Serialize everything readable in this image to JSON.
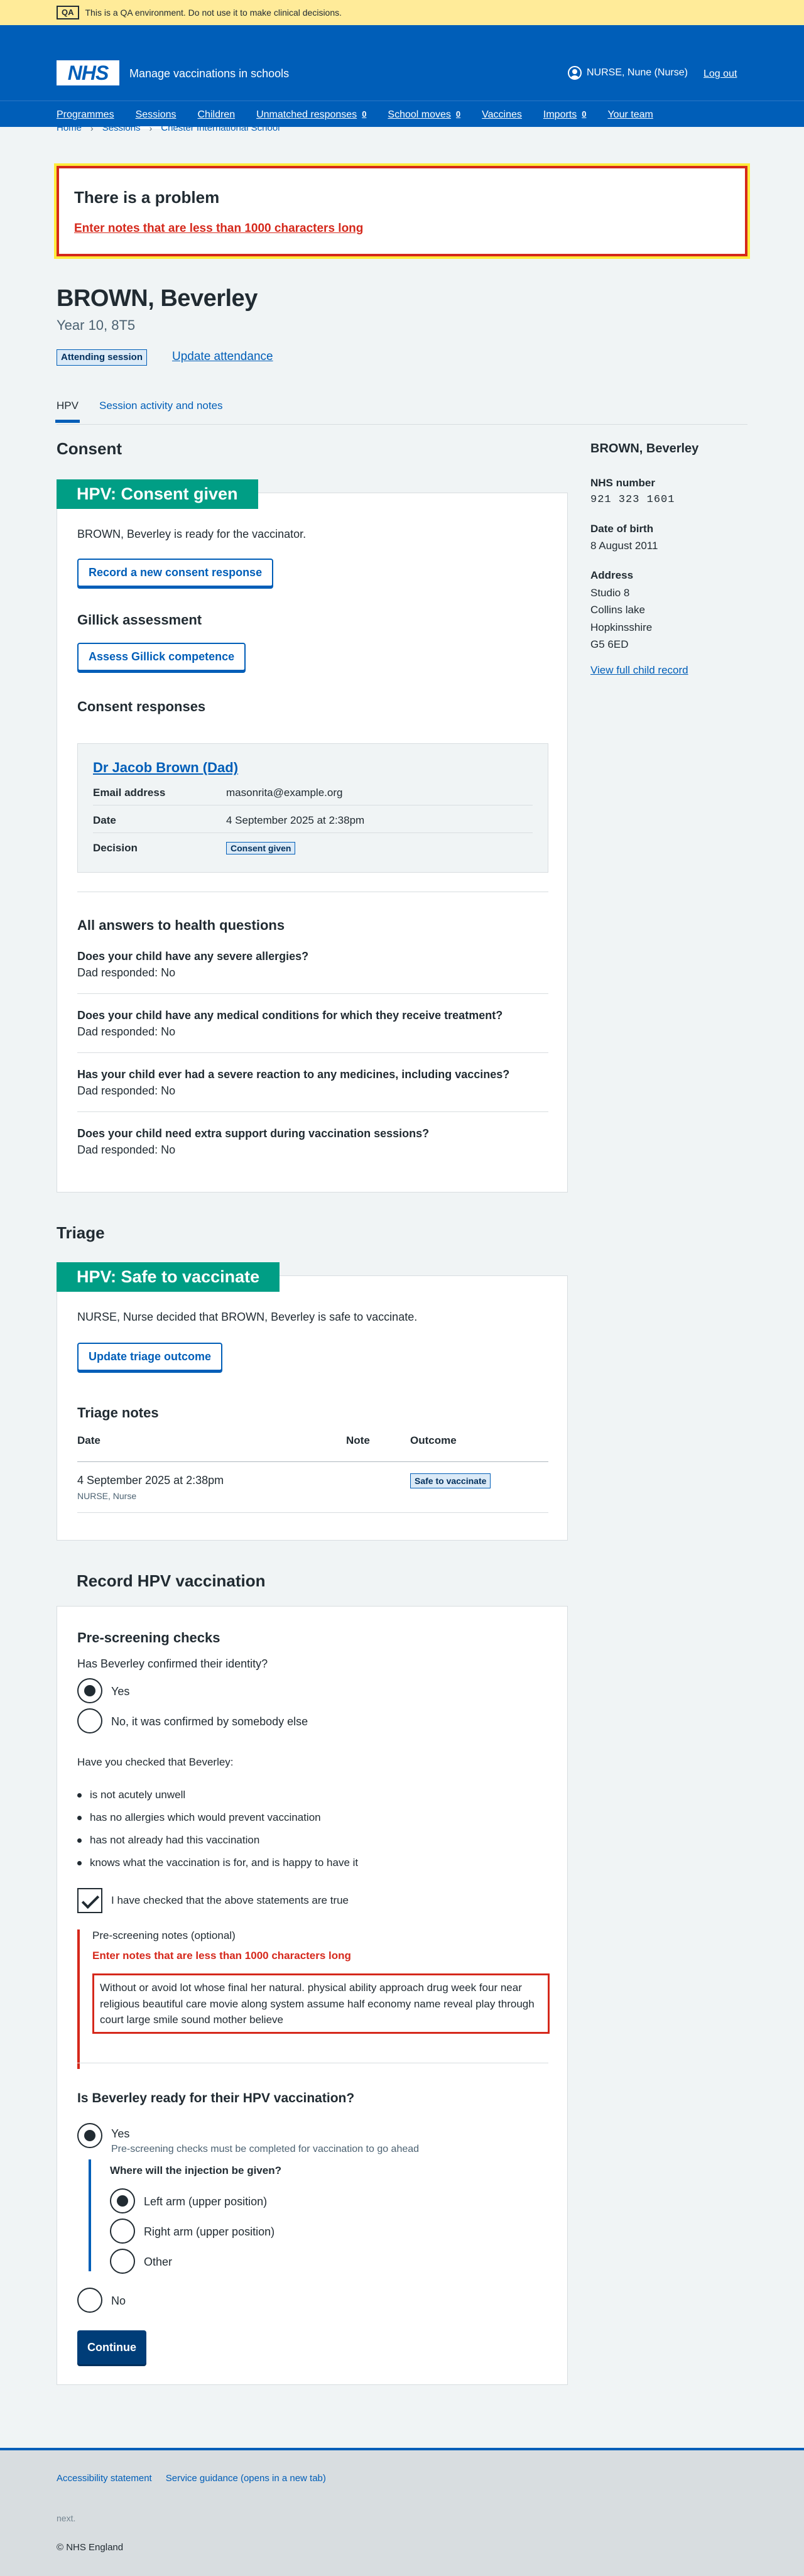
{
  "qa_banner": {
    "tag": "QA",
    "text": "This is a QA environment. Do not use it to make clinical decisions."
  },
  "header": {
    "logo": "NHS",
    "service": "Manage vaccinations in schools",
    "user": "NURSE, Nune (Nurse)",
    "logout": "Log out"
  },
  "nav": [
    {
      "label": "Programmes"
    },
    {
      "label": "Sessions"
    },
    {
      "label": "Children"
    },
    {
      "label": "Unmatched responses",
      "count": "0"
    },
    {
      "label": "School moves",
      "count": "0"
    },
    {
      "label": "Vaccines"
    },
    {
      "label": "Imports",
      "count": "0"
    },
    {
      "label": "Your team"
    }
  ],
  "breadcrumbs": [
    "Home",
    "Sessions",
    "Chester International School"
  ],
  "error_summary": {
    "title": "There is a problem",
    "message": "Enter notes that are less than 1000 characters long"
  },
  "patient": {
    "name": "BROWN, Beverley",
    "year": "Year 10, 8T5",
    "status": "Attending session",
    "update_attendance": "Update attendance"
  },
  "tabs": [
    "HPV",
    "Session activity and notes"
  ],
  "consent": {
    "heading": "Consent",
    "card_title": "HPV: Consent given",
    "summary": "BROWN, Beverley is ready for the vaccinator.",
    "record_button": "Record a new consent response",
    "gillick_heading": "Gillick assessment",
    "gillick_button": "Assess Gillick competence",
    "responses_heading": "Consent responses",
    "response": {
      "name": "Dr Jacob Brown (Dad)",
      "email_label": "Email address",
      "email": "masonrita@example.org",
      "date_label": "Date",
      "date": "4 September 2025 at 2:38pm",
      "decision_label": "Decision",
      "decision": "Consent given"
    },
    "health_heading": "All answers to health questions",
    "questions": [
      {
        "q": "Does your child have any severe allergies?",
        "a": "Dad responded: No"
      },
      {
        "q": "Does your child have any medical conditions for which they receive treatment?",
        "a": "Dad responded: No"
      },
      {
        "q": "Has your child ever had a severe reaction to any medicines, including vaccines?",
        "a": "Dad responded: No"
      },
      {
        "q": "Does your child need extra support during vaccination sessions?",
        "a": "Dad responded: No"
      }
    ]
  },
  "triage": {
    "heading": "Triage",
    "card_title": "HPV: Safe to vaccinate",
    "summary": "NURSE, Nurse decided that BROWN, Beverley is safe to vaccinate.",
    "update_button": "Update triage outcome",
    "notes_heading": "Triage notes",
    "cols": [
      "Date",
      "Note",
      "Outcome"
    ],
    "row": {
      "date": "4 September 2025 at 2:38pm",
      "by": "NURSE, Nurse",
      "outcome": "Safe to vaccinate"
    }
  },
  "record": {
    "heading": "Record HPV vaccination",
    "prescreen_heading": "Pre-screening checks",
    "identity_q": "Has Beverley confirmed their identity?",
    "identity_opts": [
      "Yes",
      "No, it was confirmed by somebody else"
    ],
    "checked_q": "Have you checked that Beverley:",
    "bullets": [
      "is not acutely unwell",
      "has no allergies which would prevent vaccination",
      "has not already had this vaccination",
      "knows what the vaccination is for, and is happy to have it"
    ],
    "checkbox_label": "I have checked that the above statements are true",
    "notes_label": "Pre-screening notes (optional)",
    "notes_error": "Enter notes that are less than 1000 characters long",
    "notes_value": "Without or avoid lot whose final her natural. physical ability approach drug week four near religious beautiful care movie along system assume half economy name reveal play through court large smile sound mother believe",
    "ready_q": "Is Beverley ready for their HPV vaccination?",
    "ready_yes": "Yes",
    "ready_hint": "Pre-screening checks must be completed for vaccination to go ahead",
    "site_q": "Where will the injection be given?",
    "site_opts": [
      "Left arm (upper position)",
      "Right arm (upper position)",
      "Other"
    ],
    "ready_no": "No",
    "continue": "Continue"
  },
  "sidebar": {
    "name": "BROWN, Beverley",
    "nhs_label": "NHS number",
    "nhs": "921 323 1601",
    "dob_label": "Date of birth",
    "dob": "8 August 2011",
    "address_label": "Address",
    "address": [
      "Studio 8",
      "Collins lake",
      "Hopkinsshire",
      "G5 6ED"
    ],
    "link": "View full child record"
  },
  "footer": {
    "links": [
      "Accessibility statement",
      "Service guidance (opens in a new tab)"
    ],
    "version": "next.",
    "copyright": "© NHS England"
  }
}
